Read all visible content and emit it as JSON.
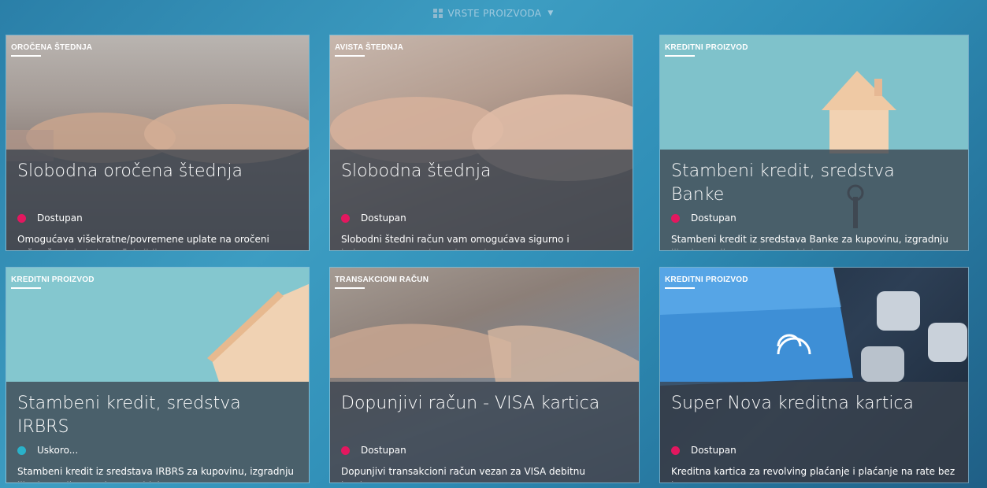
{
  "header": {
    "title": "VRSTE PROIZVODA"
  },
  "cards": [
    {
      "tag": "OROČENA ŠTEDNJA",
      "title": "Slobodna oročena štednja",
      "status": "Dostupan",
      "status_color": "#e3175f",
      "desc": "Omogućava višekratne/povremene uplate na oročeni račun štednje koja se fleksibilno..."
    },
    {
      "tag": "AVISTA ŠTEDNJA",
      "title": "Slobodna štednja",
      "status": "Dostupan",
      "status_color": "#e3175f",
      "desc": "Slobodni štedni račun vam omogućava sigurno i jednostavno raspolaganje sredstvima..."
    },
    {
      "tag": "KREDITNI PROIZVOD",
      "title": "Stambeni kredit, sredstva Banke",
      "status": "Dostupan",
      "status_color": "#e3175f",
      "desc": "Stambeni kredit iz sredstava Banke za kupovinu, izgradnju ili adaptaciju stambenog objekta..."
    },
    {
      "tag": "KREDITNI PROIZVOD",
      "title": "Stambeni kredit, sredstva IRBRS",
      "status": "Uskoro...",
      "status_color": "#2ab1c9",
      "desc": "Stambeni kredit iz sredstava IRBRS za kupovinu, izgradnju ili adaptaciju stambenog objekta..."
    },
    {
      "tag": "TRANSAKCIONI RAČUN",
      "title": "Dopunjivi račun - VISA kartica",
      "status": "Dostupan",
      "status_color": "#e3175f",
      "desc": "Dopunjivi transakcioni račun vezan za VISA debitnu karticu..."
    },
    {
      "tag": "KREDITNI PROIZVOD",
      "title": "Super Nova kreditna kartica",
      "status": "Dostupan",
      "status_color": "#e3175f",
      "desc": "Kreditna kartica za revolving plaćanje i plaćanje na rate bez kamate u Super Nova..."
    }
  ]
}
